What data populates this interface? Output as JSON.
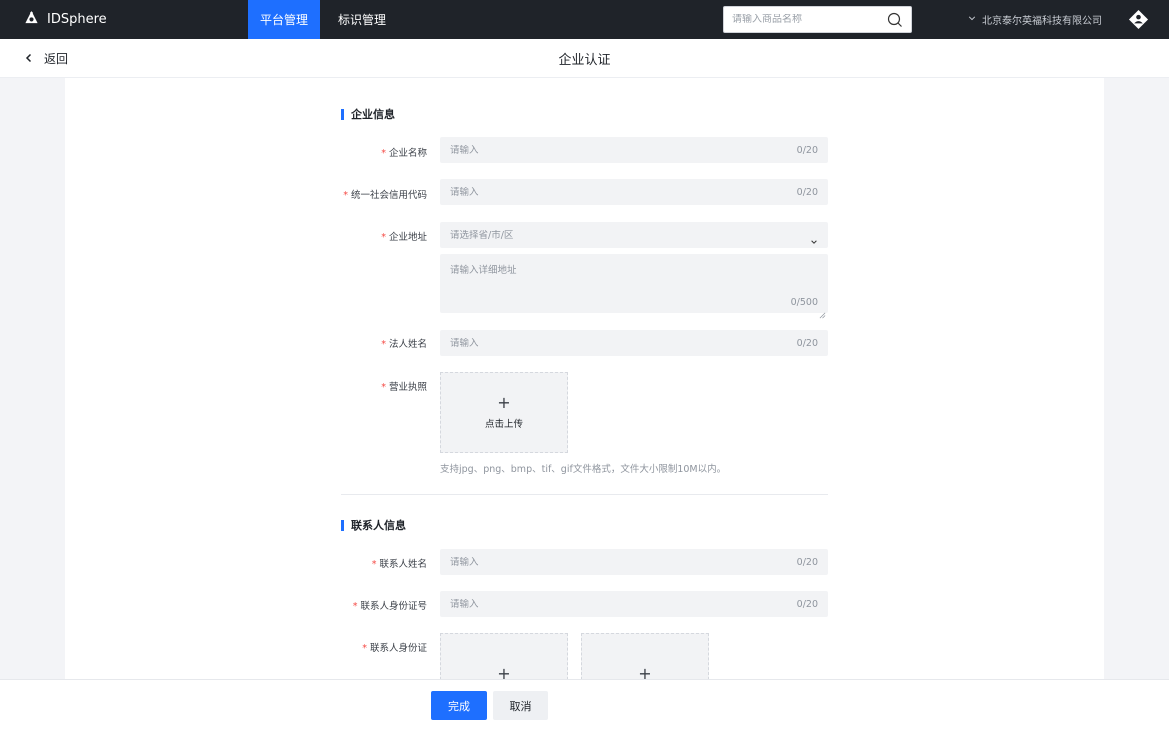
{
  "nav": {
    "app_name": "IDSphere",
    "tabs": [
      {
        "label": "平台管理"
      },
      {
        "label": "标识管理"
      }
    ],
    "search_placeholder": "请输入商品名称",
    "company": "北京泰尔英福科技有限公司"
  },
  "header": {
    "back_label": "返回",
    "title": "企业认证"
  },
  "sections": {
    "enterprise": {
      "title": "企业信息",
      "name_label": "企业名称",
      "name_placeholder": "请输入",
      "name_count": "0/20",
      "credit_label": "统一社会信用代码",
      "credit_placeholder": "请输入",
      "credit_count": "0/20",
      "address_label": "企业地址",
      "address_placeholder": "请选择省/市/区",
      "address_detail_placeholder": "请输入详细地址",
      "address_detail_count": "0/500",
      "legal_label": "法人姓名",
      "legal_placeholder": "请输入",
      "legal_count": "0/20",
      "license_label": "营业执照",
      "upload_label": "点击上传",
      "upload_hint": "支持jpg、png、bmp、tif、gif文件格式，文件大小限制10M以内。"
    },
    "contact": {
      "title": "联系人信息",
      "name_label": "联系人姓名",
      "name_placeholder": "请输入",
      "name_count": "0/20",
      "idno_label": "联系人身份证号",
      "idno_placeholder": "请输入",
      "idno_count": "0/20",
      "idcard_label": "联系人身份证"
    }
  },
  "footer": {
    "confirm_label": "完成",
    "cancel_label": "取消"
  },
  "colors": {
    "accent": "#1e6fff",
    "nav_bg": "#1f2329",
    "required": "#f54a45"
  }
}
